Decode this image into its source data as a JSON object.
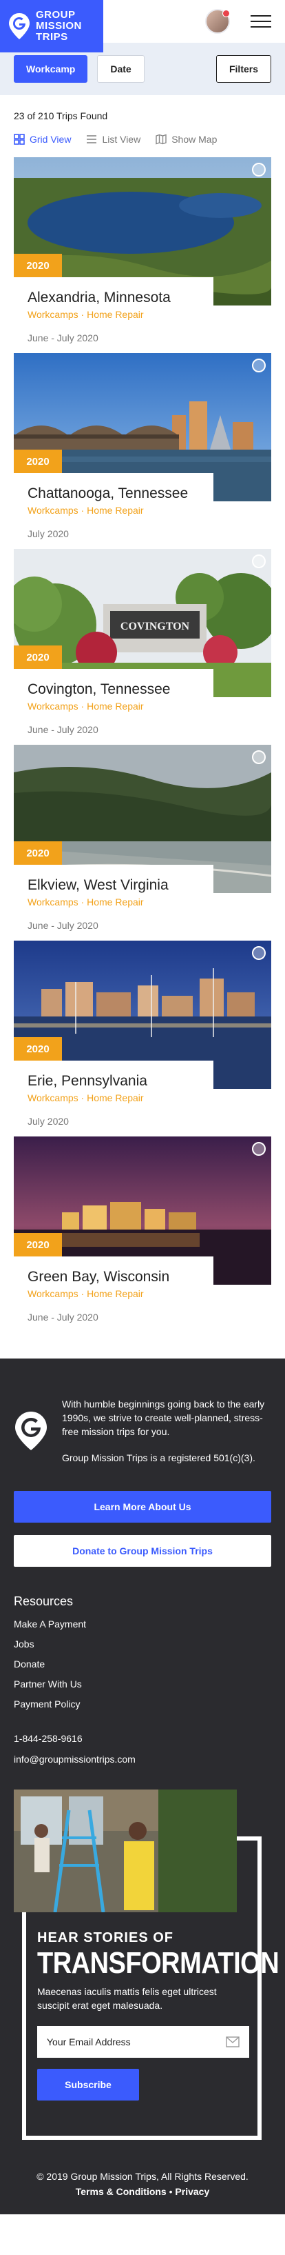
{
  "brand": {
    "name_line1": "GROUP",
    "name_line2": "MISSION",
    "name_line3": "TRIPS",
    "color_primary": "#3b5bfd",
    "color_accent": "#f2a21b",
    "color_footer": "#2b2b2f"
  },
  "header": {
    "avatar_icon": "user-avatar",
    "menu_icon": "hamburger-icon"
  },
  "filters": {
    "workcamp_label": "Workcamp",
    "date_label": "Date",
    "filters_label": "Filters"
  },
  "results": {
    "count_text": "23 of 210 Trips Found",
    "views": [
      {
        "label": "Grid View",
        "icon": "grid-icon",
        "active": true
      },
      {
        "label": "List View",
        "icon": "list-icon",
        "active": false
      },
      {
        "label": "Show Map",
        "icon": "map-icon",
        "active": false
      }
    ]
  },
  "trips": [
    {
      "year": "2020",
      "title": "Alexandria, Minnesota",
      "tags": "Workcamps · Home Repair",
      "dates": "June - July 2020"
    },
    {
      "year": "2020",
      "title": "Chattanooga, Tennessee",
      "tags": "Workcamps · Home Repair",
      "dates": "July 2020"
    },
    {
      "year": "2020",
      "title": "Covington, Tennessee",
      "tags": "Workcamps · Home Repair",
      "dates": "June - July 2020"
    },
    {
      "year": "2020",
      "title": "Elkview, West Virginia",
      "tags": "Workcamps · Home Repair",
      "dates": "June - July 2020"
    },
    {
      "year": "2020",
      "title": "Erie, Pennsylvania",
      "tags": "Workcamps · Home Repair",
      "dates": "July 2020"
    },
    {
      "year": "2020",
      "title": "Green Bay, Wisconsin",
      "tags": "Workcamps · Home Repair",
      "dates": "June - July 2020"
    }
  ],
  "covington_sign": "COVINGTON",
  "footer": {
    "about_p1": "With humble beginnings going back to the early 1990s, we strive to create well-planned, stress-free mission trips for you.",
    "about_p2": "Group Mission Trips is a registered 501(c)(3).",
    "learn_more_label": "Learn More About Us",
    "donate_label": "Donate to Group Mission Trips",
    "resources_title": "Resources",
    "resources": [
      "Make A Payment",
      "Jobs",
      "Donate",
      "Partner With Us",
      "Payment Policy"
    ],
    "phone": "1-844-258-9616",
    "email": "info@groupmissiontrips.com",
    "newsletter": {
      "kicker": "HEAR STORIES OF",
      "headline": "TRANSFORMATION",
      "description": "Maecenas iaculis mattis felis eget ultricest suscipit erat eget malesuada.",
      "email_placeholder": "Your Email Address",
      "subscribe_label": "Subscribe"
    },
    "copyright": "© 2019 Group Mission Trips, All Rights Reserved.",
    "terms_label": "Terms & Conditions",
    "separator": "•",
    "privacy_label": "Privacy"
  }
}
